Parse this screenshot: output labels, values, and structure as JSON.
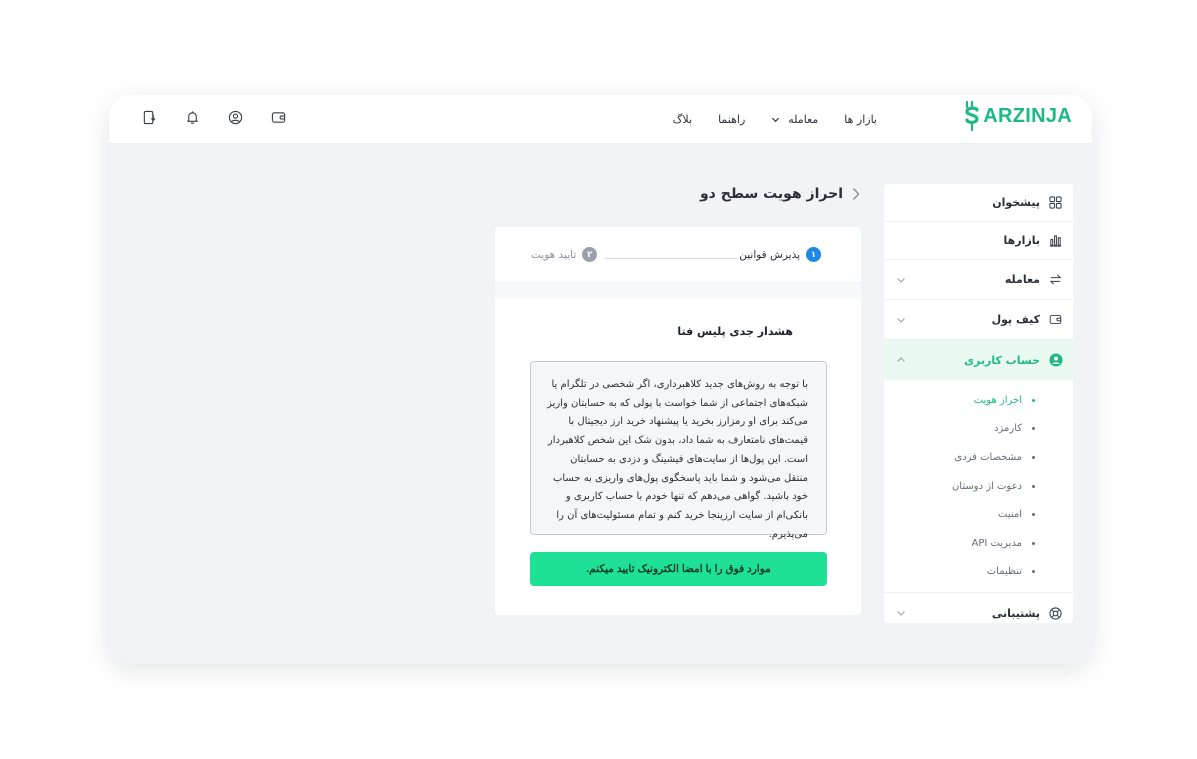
{
  "brand": {
    "name": "ARZINJA",
    "color": "#1db985"
  },
  "topnav": {
    "items": [
      {
        "label": "بازار ها",
        "dropdown": false
      },
      {
        "label": "معامله",
        "dropdown": true
      },
      {
        "label": "راهنما",
        "dropdown": false
      },
      {
        "label": "بلاگ",
        "dropdown": false
      }
    ],
    "icons": [
      "wallet-icon",
      "user-icon",
      "bell-icon",
      "download-icon"
    ]
  },
  "sidebar": {
    "items": [
      {
        "label": "پیشخوان",
        "icon": "dashboard-icon"
      },
      {
        "label": "بازارها",
        "icon": "chart-icon"
      },
      {
        "label": "معامله",
        "icon": "trade-icon",
        "expandable": true
      },
      {
        "label": "کیف پول",
        "icon": "wallet-icon",
        "expandable": true
      },
      {
        "label": "حساب کاربری",
        "icon": "user-circle-icon",
        "expandable": true,
        "active": true
      }
    ],
    "subitems": [
      {
        "label": "احراز هویت",
        "current": true
      },
      {
        "label": "کارمزد"
      },
      {
        "label": "مشخصات فردی"
      },
      {
        "label": "دعوت از دوستان"
      },
      {
        "label": "امنیت"
      },
      {
        "label": "مدیریت API"
      },
      {
        "label": "تنظیمات"
      }
    ],
    "support": {
      "label": "پشتیبانی",
      "icon": "lifebuoy-icon"
    }
  },
  "page": {
    "title": "احراز هویت سطح دو"
  },
  "steps": [
    {
      "number": "۱",
      "label": "پذیرش قوانین",
      "state": "active",
      "color": "#1e88e5"
    },
    {
      "number": "۲",
      "label": "تایید هویت",
      "state": "inactive",
      "color": "#9aa0ab"
    }
  ],
  "warning": {
    "title": "هشدار جدی پلیس فتا",
    "body": "با توجه به روش‌های جدید کلاهبرداری، اگر شخصی در تلگرام یا شبکه‌های اجتماعی از شما خواست با پولی که به حسابتان واریز می‌کند برای او رمزارز بخرید یا پیشنهاد خرید ارز دیجیتال با قیمت‌های نامتعارف به شما داد، بدون شک این شخص کلاهبردار است. این پول‌ها از سایت‌های فیشینگ و دزدی به حسابتان منتقل می‌شود و شما باید پاسخگوی پول‌های واریزی به حساب خود باشید. گواهی می‌دهم که تنها خودم با حساب کاربری و بانکی‌ام از سایت ارزینجا خرید کنم و تمام مسئولیت‌های آن را می‌پذیرم."
  },
  "confirm_button": {
    "label": "موارد فوق را با امضا الکترونیک تایید میکنم.",
    "color": "#1ee195"
  }
}
